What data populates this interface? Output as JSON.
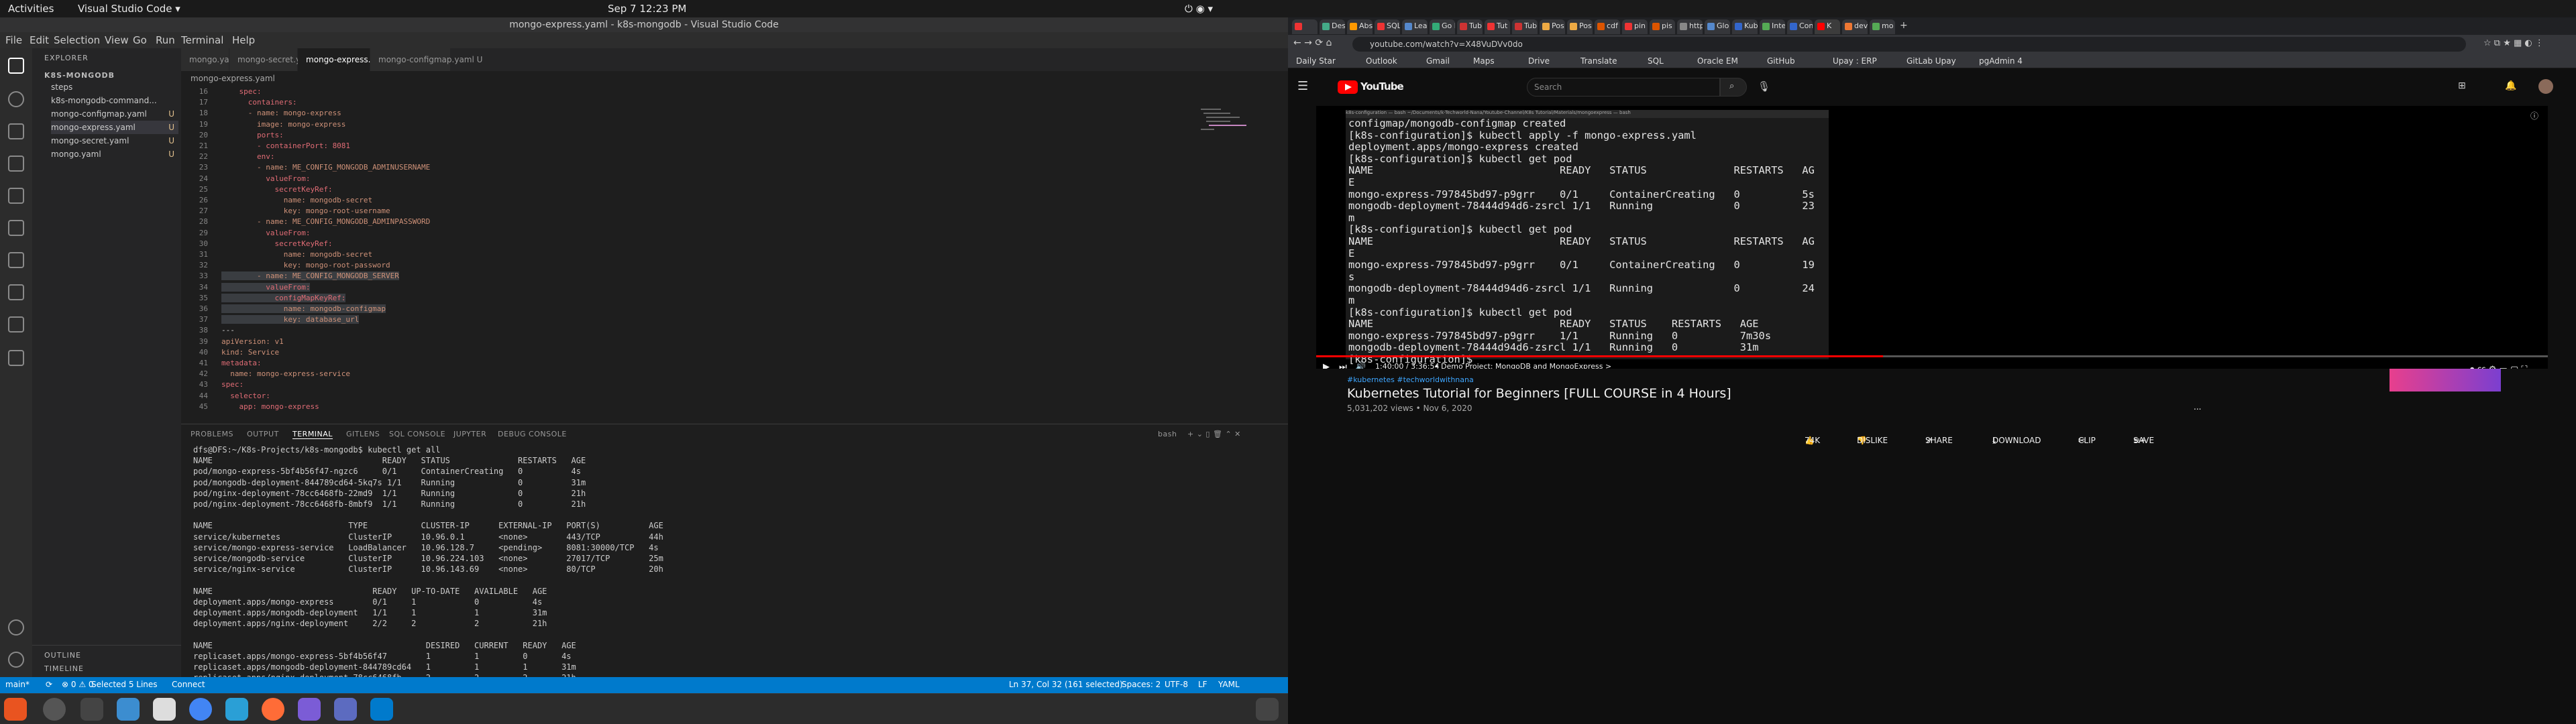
{
  "topbar": {
    "activities": "Activities",
    "app": "Visual Studio Code ▾",
    "clock": "Sep 7  12:23 PM"
  },
  "vscode": {
    "title": "mongo-express.yaml - k8s-mongodb - Visual Studio Code",
    "menu": [
      "File",
      "Edit",
      "Selection",
      "View",
      "Go",
      "Run",
      "Terminal",
      "Help"
    ],
    "explorer": {
      "header": "EXPLORER",
      "folder": "K8S-MONGODB",
      "files": [
        {
          "name": "steps",
          "mod": ""
        },
        {
          "name": "k8s-mongodb-command...",
          "mod": ""
        },
        {
          "name": "mongo-configmap.yaml",
          "mod": "U"
        },
        {
          "name": "mongo-express.yaml",
          "mod": "U"
        },
        {
          "name": "mongo-secret.yaml",
          "mod": "U"
        },
        {
          "name": "mongo.yaml",
          "mod": "U"
        }
      ],
      "outline": "OUTLINE",
      "timeline": "TIMELINE"
    },
    "tabs": [
      "mongo.yaml  U",
      "mongo-secret.yaml  U",
      "mongo-express.yaml  U",
      "mongo-configmap.yaml  U"
    ],
    "breadcrumb": "mongo-express.yaml",
    "code": [
      {
        "n": "16",
        "t": "    spec:"
      },
      {
        "n": "17",
        "t": "      containers:"
      },
      {
        "n": "18",
        "t": "      - name: mongo-express"
      },
      {
        "n": "19",
        "t": "        image: mongo-express"
      },
      {
        "n": "20",
        "t": "        ports:"
      },
      {
        "n": "21",
        "t": "        - containerPort: 8081"
      },
      {
        "n": "22",
        "t": "        env:"
      },
      {
        "n": "23",
        "t": "        - name: ME_CONFIG_MONGODB_ADMINUSERNAME"
      },
      {
        "n": "24",
        "t": "          valueFrom:"
      },
      {
        "n": "25",
        "t": "            secretKeyRef:"
      },
      {
        "n": "26",
        "t": "              name: mongodb-secret"
      },
      {
        "n": "27",
        "t": "              key: mongo-root-username"
      },
      {
        "n": "28",
        "t": "        - name: ME_CONFIG_MONGODB_ADMINPASSWORD"
      },
      {
        "n": "29",
        "t": "          valueFrom:"
      },
      {
        "n": "30",
        "t": "            secretKeyRef:"
      },
      {
        "n": "31",
        "t": "              name: mongodb-secret"
      },
      {
        "n": "32",
        "t": "              key: mongo-root-password"
      },
      {
        "n": "33",
        "t": "        - name: ME_CONFIG_MONGODB_SERVER"
      },
      {
        "n": "34",
        "t": "          valueFrom:"
      },
      {
        "n": "35",
        "t": "            configMapKeyRef:"
      },
      {
        "n": "36",
        "t": "              name: mongodb-configmap"
      },
      {
        "n": "37",
        "t": "              key: database_url"
      },
      {
        "n": "38",
        "t": "---"
      },
      {
        "n": "39",
        "t": "apiVersion: v1"
      },
      {
        "n": "40",
        "t": "kind: Service"
      },
      {
        "n": "41",
        "t": "metadata:"
      },
      {
        "n": "42",
        "t": "  name: mongo-express-service"
      },
      {
        "n": "43",
        "t": "spec:"
      },
      {
        "n": "44",
        "t": "  selector:"
      },
      {
        "n": "45",
        "t": "    app: mongo-express"
      }
    ],
    "panel_tabs": [
      "PROBLEMS",
      "OUTPUT",
      "TERMINAL",
      "GITLENS",
      "SQL CONSOLE",
      "JUPYTER",
      "DEBUG CONSOLE"
    ],
    "terminal_name": "bash",
    "terminal": "dfs@DFS:~/K8s-Projects/k8s-mongodb$ kubectl get all\nNAME                                   READY   STATUS              RESTARTS   AGE\npod/mongo-express-5bf4b56f47-ngzc6     0/1     ContainerCreating   0          4s\npod/mongodb-deployment-844789cd64-5kq7s 1/1    Running             0          31m\npod/nginx-deployment-78cc6468fb-22md9  1/1     Running             0          21h\npod/nginx-deployment-78cc6468fb-8mbf9  1/1     Running             0          21h\n\nNAME                            TYPE           CLUSTER-IP      EXTERNAL-IP   PORT(S)          AGE\nservice/kubernetes              ClusterIP      10.96.0.1       <none>        443/TCP          44h\nservice/mongo-express-service   LoadBalancer   10.96.128.7     <pending>     8081:30000/TCP   4s\nservice/mongodb-service         ClusterIP      10.96.224.103   <none>        27017/TCP        25m\nservice/nginx-service           ClusterIP      10.96.143.69    <none>        80/TCP           20h\n\nNAME                                 READY   UP-TO-DATE   AVAILABLE   AGE\ndeployment.apps/mongo-express        0/1     1            0           4s\ndeployment.apps/mongodb-deployment   1/1     1            1           31m\ndeployment.apps/nginx-deployment     2/2     2            2           21h\n\nNAME                                            DESIRED   CURRENT   READY   AGE\nreplicaset.apps/mongo-express-5bf4b56f47        1         1         0       4s\nreplicaset.apps/mongodb-deployment-844789cd64   1         1         1       31m\nreplicaset.apps/nginx-deployment-78cc6468fb     2         2         2       21h\ndfs@DFS:~/K8s-Projects/k8s-mongodb$ ",
    "status": {
      "branch": "main*",
      "sync": "⟳",
      "errors": "⊗ 0 ⚠ 0",
      "selected": "Selected 5 Lines",
      "connect": "Connect",
      "pos": "Ln 37, Col 32 (161 selected)",
      "spaces": "Spaces: 2",
      "enc": "UTF-8",
      "eol": "LF",
      "lang": "YAML"
    }
  },
  "chrome": {
    "tabs": [
      "",
      "Des",
      "Abs",
      "SQL",
      "Lea",
      "Go l",
      "Tub",
      "Tut",
      "Tub",
      "Pos",
      "Pos",
      "cdf",
      "pin",
      "pis",
      "http",
      "Glo",
      "Kub",
      "Inte",
      "Con",
      "K",
      "dev",
      "mo"
    ],
    "url": "youtube.com/watch?v=X48VuDVv0do",
    "bookmarks": [
      "Daily Star",
      "Outlook",
      "Gmail",
      "Maps",
      "Drive",
      "Translate",
      "SQL",
      "Oracle EM",
      "GitHub",
      "Upay : ERP",
      "GitLab Upay",
      "pgAdmin 4"
    ],
    "yt": {
      "logo": "YouTube",
      "search_placeholder": "Search",
      "terminal_bar": "k8s-configuration — bash                                  ~/Documents/k-Techworld-Nana/Youtube-Channel/K8s Tutorial/Materials/mongoexpress — bash",
      "video_terminal": "configmap/mongodb-configmap created\n[k8s-configuration]$ kubectl apply -f mongo-express.yaml\ndeployment.apps/mongo-express created\n[k8s-configuration]$ kubectl get pod\nNAME                              READY   STATUS              RESTARTS   AG\nE\nmongo-express-797845bd97-p9grr    0/1     ContainerCreating   0          5s\nmongodb-deployment-78444d94d6-zsrcl 1/1   Running             0          23\nm\n[k8s-configuration]$ kubectl get pod\nNAME                              READY   STATUS              RESTARTS   AG\nE\nmongo-express-797845bd97-p9grr    0/1     ContainerCreating   0          19\ns\nmongodb-deployment-78444d94d6-zsrcl 1/1   Running             0          24\nm\n[k8s-configuration]$ kubectl get pod\nNAME                              READY   STATUS    RESTARTS   AGE\nmongo-express-797845bd97-p9grr    1/1     Running   0          7m30s\nmongodb-deployment-78444d94d6-zsrcl 1/1   Running   0          31m\n[k8s-configuration]$ ",
      "progress": 0.46,
      "time": "1:40:00 / 3:36:54",
      "chapter": "• Demo Project: MongoDB and MongoExpress >",
      "tags": "#kubernetes #techworldwithnana",
      "title": "Kubernetes Tutorial for Beginners [FULL COURSE in 4 Hours]",
      "views": "5,031,202 views • Nov 6, 2020",
      "likes": "74K",
      "dislike": "DISLIKE",
      "share": "SHARE",
      "download": "DOWNLOAD",
      "clip": "CLIP",
      "save": "SAVE",
      "more": "..."
    }
  },
  "colors": {
    "vscode_status": "#007acc",
    "yt_red": "#ff0000"
  }
}
